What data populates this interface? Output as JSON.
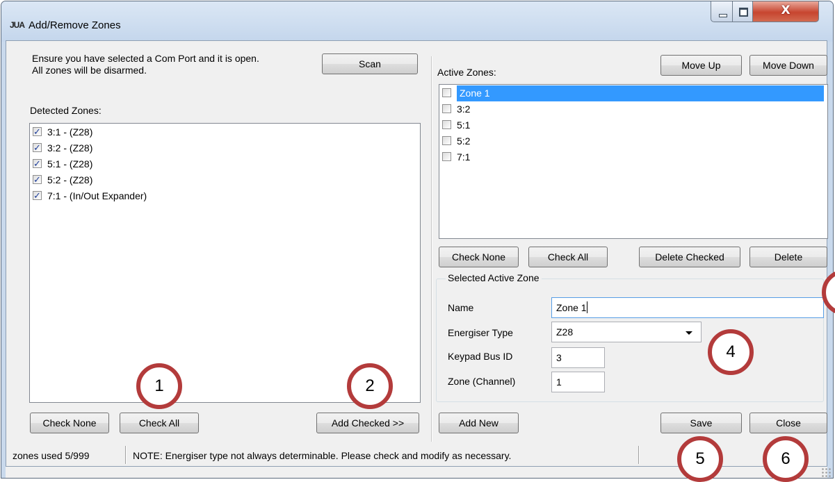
{
  "window": {
    "logo": "JUA",
    "title": "Add/Remove Zones"
  },
  "caption": {
    "close_glyph": "X"
  },
  "left": {
    "instructions": [
      "Ensure you have selected a Com Port and it is open.",
      "All zones will be disarmed."
    ],
    "scan_label": "Scan",
    "detected_label": "Detected Zones:",
    "detected_zones": [
      {
        "label": "3:1 -  (Z28)",
        "checked": true
      },
      {
        "label": "3:2 -  (Z28)",
        "checked": true
      },
      {
        "label": "5:1 -  (Z28)",
        "checked": true
      },
      {
        "label": "5:2 -  (Z28)",
        "checked": true
      },
      {
        "label": "7:1 -  (In/Out Expander)",
        "checked": true
      }
    ],
    "check_none_label": "Check None",
    "check_all_label": "Check All",
    "add_checked_label": "Add Checked >>"
  },
  "right": {
    "active_label": "Active Zones:",
    "move_up_label": "Move Up",
    "move_down_label": "Move Down",
    "active_zones": [
      {
        "label": "Zone 1",
        "checked": false,
        "selected": true
      },
      {
        "label": "3:2",
        "checked": false,
        "selected": false
      },
      {
        "label": "5:1",
        "checked": false,
        "selected": false
      },
      {
        "label": "5:2",
        "checked": false,
        "selected": false
      },
      {
        "label": "7:1",
        "checked": false,
        "selected": false
      }
    ],
    "check_none_label": "Check None",
    "check_all_label": "Check All",
    "delete_checked_label": "Delete Checked",
    "delete_label": "Delete",
    "selected_group": {
      "title": "Selected Active Zone",
      "name_label": "Name",
      "name_value": "Zone 1",
      "energiser_label": "Energiser Type",
      "energiser_value": "Z28",
      "keypad_label": "Keypad Bus ID",
      "keypad_value": "3",
      "zone_label": "Zone (Channel)",
      "zone_value": "1"
    },
    "add_new_label": "Add New",
    "save_label": "Save",
    "close_label": "Close"
  },
  "status": {
    "zones_used": "zones used 5/999",
    "note": "NOTE: Energiser type not always determinable. Please check and modify as necessary."
  },
  "callouts": [
    "1",
    "2",
    "4",
    "5",
    "6"
  ]
}
